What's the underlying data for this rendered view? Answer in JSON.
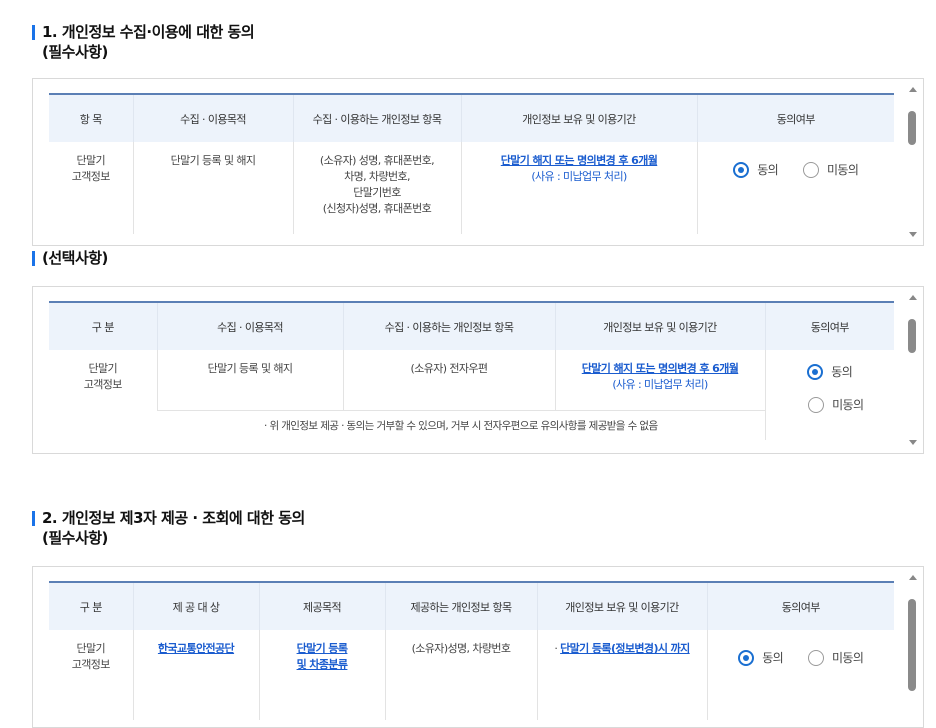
{
  "section1": {
    "title": "1. 개인정보 수집·이용에 대한 동의",
    "required_label": "(필수사항)",
    "headers": [
      "항 목",
      "수집 · 이용목적",
      "수집 · 이용하는 개인정보 항목",
      "개인정보 보유 및 이용기간",
      "동의여부"
    ],
    "row": {
      "category_l1": "단말기",
      "category_l2": "고객정보",
      "purpose": "단말기 등록 및 해지",
      "items": [
        "(소유자) 성명, 휴대폰번호,",
        "차명, 차량번호,",
        "단말기번호",
        "(신청자)성명, 휴대폰번호"
      ],
      "retention_link": "단말기 해지 또는 명의변경 후 6개월",
      "retention_note": "(사유 : 미납업무 처리)",
      "agree_label": "동의",
      "disagree_label": "미동의",
      "selected": "agree"
    }
  },
  "section1_optional": {
    "title": "(선택사항)",
    "headers": [
      "구 분",
      "수집 · 이용목적",
      "수집 · 이용하는 개인정보 항목",
      "개인정보 보유 및 이용기간",
      "동의여부"
    ],
    "row": {
      "category_l1": "단말기",
      "category_l2": "고객정보",
      "purpose": "단말기 등록 및 해지",
      "items": "(소유자) 전자우편",
      "retention_link": "단말기 해지 또는 명의변경 후 6개월",
      "retention_note": "(사유 : 미납업무 처리)",
      "agree_label": "동의",
      "disagree_label": "미동의",
      "selected": "agree"
    },
    "notice": "· 위 개인정보 제공 · 동의는 거부할 수 있으며, 거부 시 전자우편으로 유의사항를 제공받을 수 없음"
  },
  "section2": {
    "title": "2. 개인정보 제3자 제공 · 조회에 대한 동의",
    "required_label": "(필수사항)",
    "headers": [
      "구 분",
      "제 공 대 상",
      "제공목적",
      "제공하는 개인정보 항목",
      "개인정보 보유 및 이용기간",
      "동의여부"
    ],
    "row": {
      "category_l1": "단말기",
      "category_l2": "고객정보",
      "recipient": "한국교통안전공단",
      "purpose_l1": "단말기 등록",
      "purpose_l2": "및 차종분류",
      "items": "(소유자)성명, 차량번호",
      "retention_prefix": "· ",
      "retention_link": "단말기 등록(정보변경)시 까지",
      "agree_label": "동의",
      "disagree_label": "미동의",
      "selected": "agree"
    }
  },
  "colors": {
    "accent": "#1a73e8",
    "link": "#1a5ccf",
    "header_bg": "#edf3fb",
    "header_border": "#5b7fb5"
  }
}
